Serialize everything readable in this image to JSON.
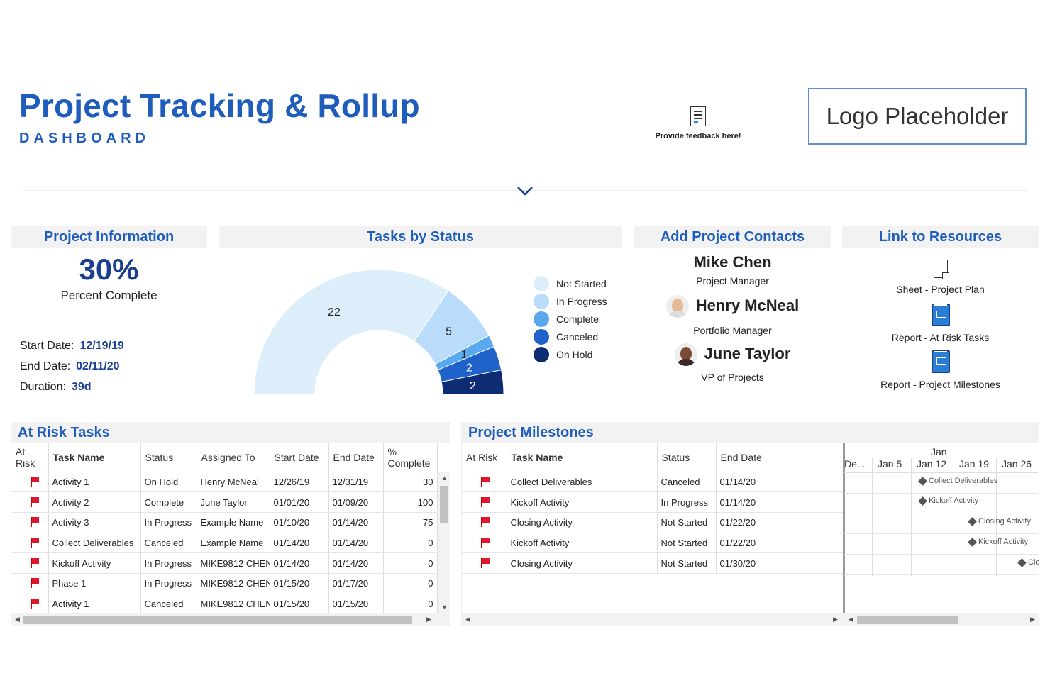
{
  "header": {
    "title": "Project Tracking & Rollup",
    "subtitle": "DASHBOARD",
    "feedback": "Provide feedback here!",
    "logo": "Logo Placeholder"
  },
  "project_info": {
    "title": "Project Information",
    "percent": "30%",
    "percent_label": "Percent Complete",
    "start_label": "Start Date:",
    "start_value": "12/19/19",
    "end_label": "End Date:",
    "end_value": "02/11/20",
    "duration_label": "Duration:",
    "duration_value": "39d"
  },
  "tasks_by_status": {
    "title": "Tasks by Status"
  },
  "chart_data": {
    "type": "pie",
    "subtype": "half-donut",
    "categories": [
      "Not Started",
      "In Progress",
      "Complete",
      "Canceled",
      "On Hold"
    ],
    "values": [
      22,
      5,
      1,
      2,
      2
    ],
    "colors": [
      "#ddeefb",
      "#b9dcfa",
      "#5aa8ee",
      "#1f62c9",
      "#0d2c73"
    ]
  },
  "contacts": {
    "title": "Add Project Contacts",
    "people": [
      {
        "name": "Mike Chen",
        "role": "Project Manager"
      },
      {
        "name": "Henry McNeal",
        "role": "Portfolio Manager"
      },
      {
        "name": "June Taylor",
        "role": "VP of Projects"
      }
    ]
  },
  "resources": {
    "title": "Link to Resources",
    "items": [
      {
        "label": "Sheet - Project Plan",
        "icon": "sheet-icon"
      },
      {
        "label": "Report - At Risk Tasks",
        "icon": "report-icon"
      },
      {
        "label": "Report - Project Milestones",
        "icon": "report-icon"
      }
    ]
  },
  "at_risk": {
    "title": "At Risk Tasks",
    "columns": [
      "At Risk",
      "Task Name",
      "Status",
      "Assigned To",
      "Start Date",
      "End Date",
      "% Complete"
    ],
    "rows": [
      [
        "Activity 1",
        "On Hold",
        "Henry McNeal",
        "12/26/19",
        "12/31/19",
        "30"
      ],
      [
        "Activity 2",
        "Complete",
        "June Taylor",
        "01/01/20",
        "01/09/20",
        "100"
      ],
      [
        "Activity 3",
        "In Progress",
        "Example Name",
        "01/10/20",
        "01/14/20",
        "75"
      ],
      [
        "Collect Deliverables",
        "Canceled",
        "Example Name",
        "01/14/20",
        "01/14/20",
        "0"
      ],
      [
        "Kickoff Activity",
        "In Progress",
        "MIKE9812 CHEN",
        "01/14/20",
        "01/14/20",
        "0"
      ],
      [
        "Phase 1",
        "In Progress",
        "MIKE9812 CHEN",
        "01/15/20",
        "01/17/20",
        "0"
      ],
      [
        "Activity 1",
        "Canceled",
        "MIKE9812 CHEN",
        "01/15/20",
        "01/15/20",
        "0"
      ]
    ]
  },
  "milestones": {
    "title": "Project Milestones",
    "columns": [
      "At Risk",
      "Task Name",
      "Status",
      "End Date"
    ],
    "rows": [
      [
        "Collect Deliverables",
        "Canceled",
        "01/14/20"
      ],
      [
        "Kickoff Activity",
        "In Progress",
        "01/14/20"
      ],
      [
        "Closing Activity",
        "Not Started",
        "01/22/20"
      ],
      [
        "Kickoff Activity",
        "Not Started",
        "01/22/20"
      ],
      [
        "Closing Activity",
        "Not Started",
        "01/30/20"
      ]
    ],
    "gantt": {
      "month": "Jan",
      "weeks": [
        "De...",
        "Jan 5",
        "Jan 12",
        "Jan 19",
        "Jan 26"
      ],
      "labels": [
        "Collect Deliverables",
        "Kickoff Activity",
        "Closing Activity",
        "Kickoff Activity",
        "Clo"
      ]
    }
  }
}
